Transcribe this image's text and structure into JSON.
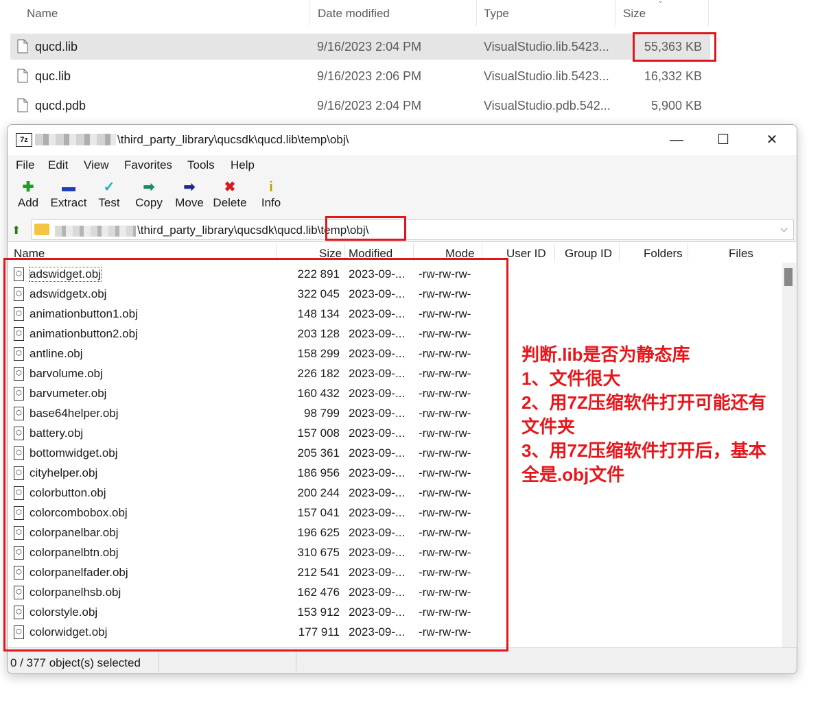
{
  "explorer": {
    "headers": {
      "name": "Name",
      "date": "Date modified",
      "type": "Type",
      "size": "Size"
    },
    "files": [
      {
        "name": "qucd.lib",
        "date": "9/16/2023 2:04 PM",
        "type": "VisualStudio.lib.5423...",
        "size": "55,363 KB",
        "selected": true
      },
      {
        "name": "quc.lib",
        "date": "9/16/2023 2:06 PM",
        "type": "VisualStudio.lib.5423...",
        "size": "16,332 KB"
      },
      {
        "name": "qucd.pdb",
        "date": "9/16/2023 2:04 PM",
        "type": "VisualStudio.pdb.542...",
        "size": "5,900 KB"
      }
    ]
  },
  "zip": {
    "app_icon": "7z",
    "title_path": "\\third_party_library\\qucsdk\\qucd.lib\\temp\\obj\\",
    "window_controls": {
      "minimize": "—",
      "maximize": "☐",
      "close": "✕"
    },
    "menu": [
      "File",
      "Edit",
      "View",
      "Favorites",
      "Tools",
      "Help"
    ],
    "toolbar": [
      {
        "label": "Add",
        "icon": "plus-icon",
        "glyph": "✚",
        "color": "#1e9e1e"
      },
      {
        "label": "Extract",
        "icon": "minus-icon",
        "glyph": "▬",
        "color": "#1f3fb8"
      },
      {
        "label": "Test",
        "icon": "checkmark-icon",
        "glyph": "✓",
        "color": "#16b0c8"
      },
      {
        "label": "Copy",
        "icon": "copy-arrow-icon",
        "glyph": "➡",
        "color": "#1a8a6b"
      },
      {
        "label": "Move",
        "icon": "move-arrow-icon",
        "glyph": "➡",
        "color": "#1a2a8a"
      },
      {
        "label": "Delete",
        "icon": "delete-x-icon",
        "glyph": "✖",
        "color": "#d81b1b"
      },
      {
        "label": "Info",
        "icon": "info-icon",
        "glyph": "i",
        "color": "#b8a000"
      }
    ],
    "address": {
      "path": "\\third_party_library\\qucsdk\\qucd.lib\\temp\\obj\\",
      "drop": "⌵"
    },
    "columns": {
      "name": "Name",
      "size": "Size",
      "modified": "Modified",
      "mode": "Mode",
      "user_id": "User ID",
      "group_id": "Group ID",
      "folders": "Folders",
      "files": "Files"
    },
    "rows": [
      {
        "name": "adswidget.obj",
        "size": "222 891",
        "modified": "2023-09-...",
        "mode": "-rw-rw-rw-"
      },
      {
        "name": "adswidgetx.obj",
        "size": "322 045",
        "modified": "2023-09-...",
        "mode": "-rw-rw-rw-"
      },
      {
        "name": "animationbutton1.obj",
        "size": "148 134",
        "modified": "2023-09-...",
        "mode": "-rw-rw-rw-"
      },
      {
        "name": "animationbutton2.obj",
        "size": "203 128",
        "modified": "2023-09-...",
        "mode": "-rw-rw-rw-"
      },
      {
        "name": "antline.obj",
        "size": "158 299",
        "modified": "2023-09-...",
        "mode": "-rw-rw-rw-"
      },
      {
        "name": "barvolume.obj",
        "size": "226 182",
        "modified": "2023-09-...",
        "mode": "-rw-rw-rw-"
      },
      {
        "name": "barvumeter.obj",
        "size": "160 432",
        "modified": "2023-09-...",
        "mode": "-rw-rw-rw-"
      },
      {
        "name": "base64helper.obj",
        "size": "98 799",
        "modified": "2023-09-...",
        "mode": "-rw-rw-rw-"
      },
      {
        "name": "battery.obj",
        "size": "157 008",
        "modified": "2023-09-...",
        "mode": "-rw-rw-rw-"
      },
      {
        "name": "bottomwidget.obj",
        "size": "205 361",
        "modified": "2023-09-...",
        "mode": "-rw-rw-rw-"
      },
      {
        "name": "cityhelper.obj",
        "size": "186 956",
        "modified": "2023-09-...",
        "mode": "-rw-rw-rw-"
      },
      {
        "name": "colorbutton.obj",
        "size": "200 244",
        "modified": "2023-09-...",
        "mode": "-rw-rw-rw-"
      },
      {
        "name": "colorcombobox.obj",
        "size": "157 041",
        "modified": "2023-09-...",
        "mode": "-rw-rw-rw-"
      },
      {
        "name": "colorpanelbar.obj",
        "size": "196 625",
        "modified": "2023-09-...",
        "mode": "-rw-rw-rw-"
      },
      {
        "name": "colorpanelbtn.obj",
        "size": "310 675",
        "modified": "2023-09-...",
        "mode": "-rw-rw-rw-"
      },
      {
        "name": "colorpanelfader.obj",
        "size": "212 541",
        "modified": "2023-09-...",
        "mode": "-rw-rw-rw-"
      },
      {
        "name": "colorpanelhsb.obj",
        "size": "162 476",
        "modified": "2023-09-...",
        "mode": "-rw-rw-rw-"
      },
      {
        "name": "colorstyle.obj",
        "size": "153 912",
        "modified": "2023-09-...",
        "mode": "-rw-rw-rw-"
      },
      {
        "name": "colorwidget.obj",
        "size": "177 911",
        "modified": "2023-09-...",
        "mode": "-rw-rw-rw-"
      }
    ],
    "status": "0 / 377 object(s) selected"
  },
  "annotation": {
    "lines": [
      "判断.lib是否为静态库",
      "1、文件很大",
      "2、用7Z压缩软件打开可能还有",
      "文件夹",
      "3、用7Z压缩软件打开后，基本",
      "全是.obj文件"
    ],
    "color": "#e8161b"
  }
}
